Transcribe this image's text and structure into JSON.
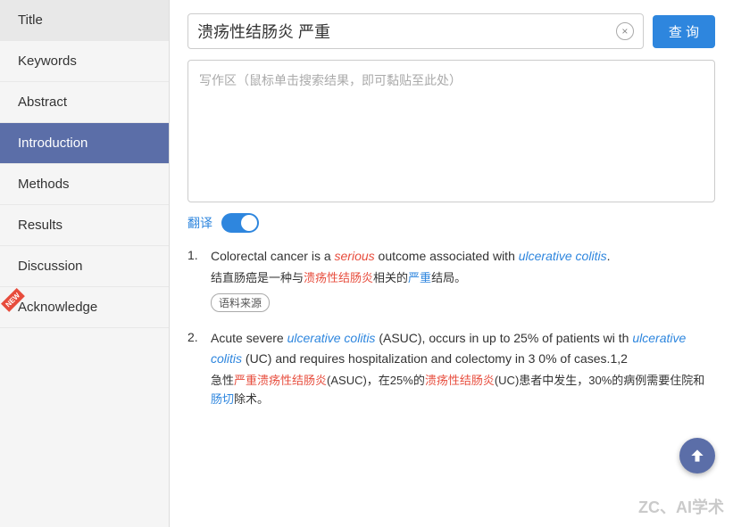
{
  "sidebar": {
    "items": [
      {
        "id": "title",
        "label": "Title",
        "active": false,
        "newBadge": false
      },
      {
        "id": "keywords",
        "label": "Keywords",
        "active": false,
        "newBadge": false
      },
      {
        "id": "abstract",
        "label": "Abstract",
        "active": false,
        "newBadge": false
      },
      {
        "id": "introduction",
        "label": "Introduction",
        "active": true,
        "newBadge": false
      },
      {
        "id": "methods",
        "label": "Methods",
        "active": false,
        "newBadge": false
      },
      {
        "id": "results",
        "label": "Results",
        "active": false,
        "newBadge": false
      },
      {
        "id": "discussion",
        "label": "Discussion",
        "active": false,
        "newBadge": false
      },
      {
        "id": "acknowledge",
        "label": "Acknowledge",
        "active": false,
        "newBadge": true
      }
    ]
  },
  "search": {
    "query": "溃疡性结肠炎 严重",
    "button_label": "查 询",
    "clear_icon": "×"
  },
  "writing_area": {
    "placeholder": "写作区（鼠标单击搜索结果，即可黏贴至此处）"
  },
  "translation": {
    "label": "翻译",
    "enabled": true
  },
  "results": [
    {
      "number": "1.",
      "en_parts": [
        {
          "text": "Colorectal cancer is a ",
          "type": "normal"
        },
        {
          "text": "serious",
          "type": "italic-red"
        },
        {
          "text": " outcome associated with ",
          "type": "normal"
        },
        {
          "text": "ulcerative colitis",
          "type": "italic-blue"
        },
        {
          "text": ".",
          "type": "normal"
        }
      ],
      "cn_parts": [
        {
          "text": "结直肠癌是一种与",
          "type": "normal"
        },
        {
          "text": "溃疡性结肠炎",
          "type": "cn-red"
        },
        {
          "text": "相关的",
          "type": "normal"
        },
        {
          "text": "严重",
          "type": "cn-blue"
        },
        {
          "text": "结局。",
          "type": "normal"
        }
      ],
      "source_label": "语料来源"
    },
    {
      "number": "2.",
      "en_parts": [
        {
          "text": "Acute severe ",
          "type": "normal"
        },
        {
          "text": "ulcerative colitis",
          "type": "italic-blue"
        },
        {
          "text": " (ASUC), occurs in up to 25% of patients wi th ",
          "type": "normal"
        },
        {
          "text": "ulcerative colitis",
          "type": "italic-blue"
        },
        {
          "text": " (UC) and requires hospitalization and colectomy in 3 0% of cases.1,2",
          "type": "normal"
        }
      ],
      "cn_parts": [
        {
          "text": "急性",
          "type": "normal"
        },
        {
          "text": "严重溃疡性结肠炎",
          "type": "cn-red"
        },
        {
          "text": "(ASUC)，在25%的",
          "type": "normal"
        },
        {
          "text": "溃疡性结肠炎",
          "type": "cn-red"
        },
        {
          "text": "(UC)患者中发生，",
          "type": "normal"
        },
        {
          "text": "30%的",
          "type": "normal"
        },
        {
          "text": "病例需要住院和",
          "type": "normal"
        },
        {
          "text": "肠切",
          "type": "cn-blue"
        },
        {
          "text": "除术。",
          "type": "normal"
        }
      ],
      "source_label": null
    }
  ],
  "watermark": "ZC、AI学术",
  "scroll_top_icon": "↑"
}
